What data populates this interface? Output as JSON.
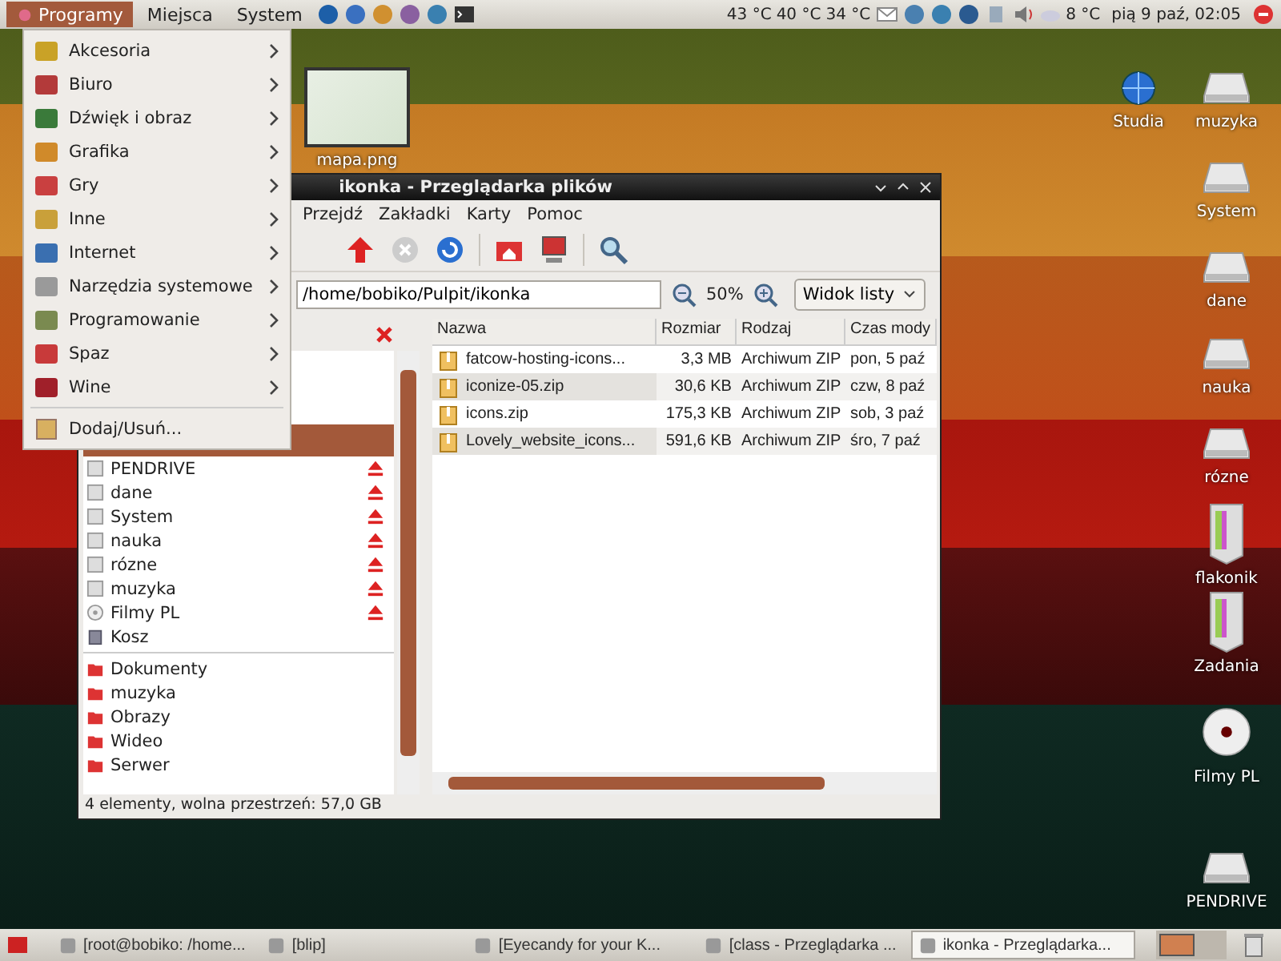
{
  "top_panel": {
    "menus": [
      {
        "label": "Programy",
        "selected": true
      },
      {
        "label": "Miejsca",
        "selected": false
      },
      {
        "label": "System",
        "selected": false
      }
    ],
    "temperatures": [
      "43 °C",
      "40 °C",
      "34 °C"
    ],
    "weather": "8 °C",
    "clock": "pią  9 paź, 02:05"
  },
  "desktop_icons": [
    {
      "label": "mapa.png",
      "kind": "image"
    },
    {
      "label": "Studia",
      "kind": "globe"
    },
    {
      "label": "muzyka",
      "kind": "drive"
    },
    {
      "label": "System",
      "kind": "drive"
    },
    {
      "label": "dane",
      "kind": "drive"
    },
    {
      "label": "nauka",
      "kind": "drive"
    },
    {
      "label": "rózne",
      "kind": "drive"
    },
    {
      "label": "flakonik",
      "kind": "player"
    },
    {
      "label": "Zadania",
      "kind": "player"
    },
    {
      "label": "Filmy PL",
      "kind": "disc"
    },
    {
      "label": "PENDRIVE",
      "kind": "drive"
    }
  ],
  "app_menu": {
    "items": [
      {
        "label": "Akcesoria",
        "submenu": true
      },
      {
        "label": "Biuro",
        "submenu": true
      },
      {
        "label": "Dźwięk i obraz",
        "submenu": true
      },
      {
        "label": "Grafika",
        "submenu": true
      },
      {
        "label": "Gry",
        "submenu": true
      },
      {
        "label": "Inne",
        "submenu": true
      },
      {
        "label": "Internet",
        "submenu": true
      },
      {
        "label": "Narzędzia systemowe",
        "submenu": true
      },
      {
        "label": "Programowanie",
        "submenu": true
      },
      {
        "label": "Spaz",
        "submenu": true
      },
      {
        "label": "Wine",
        "submenu": true
      }
    ],
    "footer": "Dodaj/Usuń..."
  },
  "file_manager": {
    "title": "ikonka - Przeglądarka plików",
    "menus": [
      "Przejdź",
      "Zakładki",
      "Karty",
      "Pomoc"
    ],
    "location": "/home/bobiko/Pulpit/ikonka",
    "zoom": "50%",
    "view": "Widok listy",
    "places": [
      {
        "label": "PENDRIVE",
        "kind": "drive",
        "eject": true
      },
      {
        "label": "dane",
        "kind": "drive",
        "eject": true
      },
      {
        "label": "System",
        "kind": "drive",
        "eject": true
      },
      {
        "label": "nauka",
        "kind": "drive",
        "eject": true
      },
      {
        "label": "rózne",
        "kind": "drive",
        "eject": true
      },
      {
        "label": "muzyka",
        "kind": "drive",
        "eject": true
      },
      {
        "label": "Filmy PL",
        "kind": "disc",
        "eject": true
      },
      {
        "label": "Kosz",
        "kind": "trash",
        "eject": false
      }
    ],
    "bookmarks": [
      "Dokumenty",
      "muzyka",
      "Obrazy",
      "Wideo",
      "Serwer"
    ],
    "columns": [
      "Nazwa",
      "Rozmiar",
      "Rodzaj",
      "Czas mody"
    ],
    "rows": [
      {
        "name": "fatcow-hosting-icons...",
        "size": "3,3 MB",
        "type": "Archiwum ZIP",
        "date": "pon, 5 paź"
      },
      {
        "name": "iconize-05.zip",
        "size": "30,6 KB",
        "type": "Archiwum ZIP",
        "date": "czw, 8 paź"
      },
      {
        "name": "icons.zip",
        "size": "175,3 KB",
        "type": "Archiwum ZIP",
        "date": "sob, 3 paź"
      },
      {
        "name": "Lovely_website_icons...",
        "size": "591,6 KB",
        "type": "Archiwum ZIP",
        "date": "śro, 7 paź"
      }
    ],
    "status": "4 elementy, wolna przestrzeń: 57,0 GB"
  },
  "taskbar": [
    {
      "label": "[root@bobiko: /home...",
      "selected": false
    },
    {
      "label": "[blip]",
      "selected": false
    },
    {
      "label": "[Eyecandy for your K...",
      "selected": false
    },
    {
      "label": "[class - Przeglądarka ...",
      "selected": false
    },
    {
      "label": "ikonka - Przeglądarka...",
      "selected": true
    }
  ]
}
